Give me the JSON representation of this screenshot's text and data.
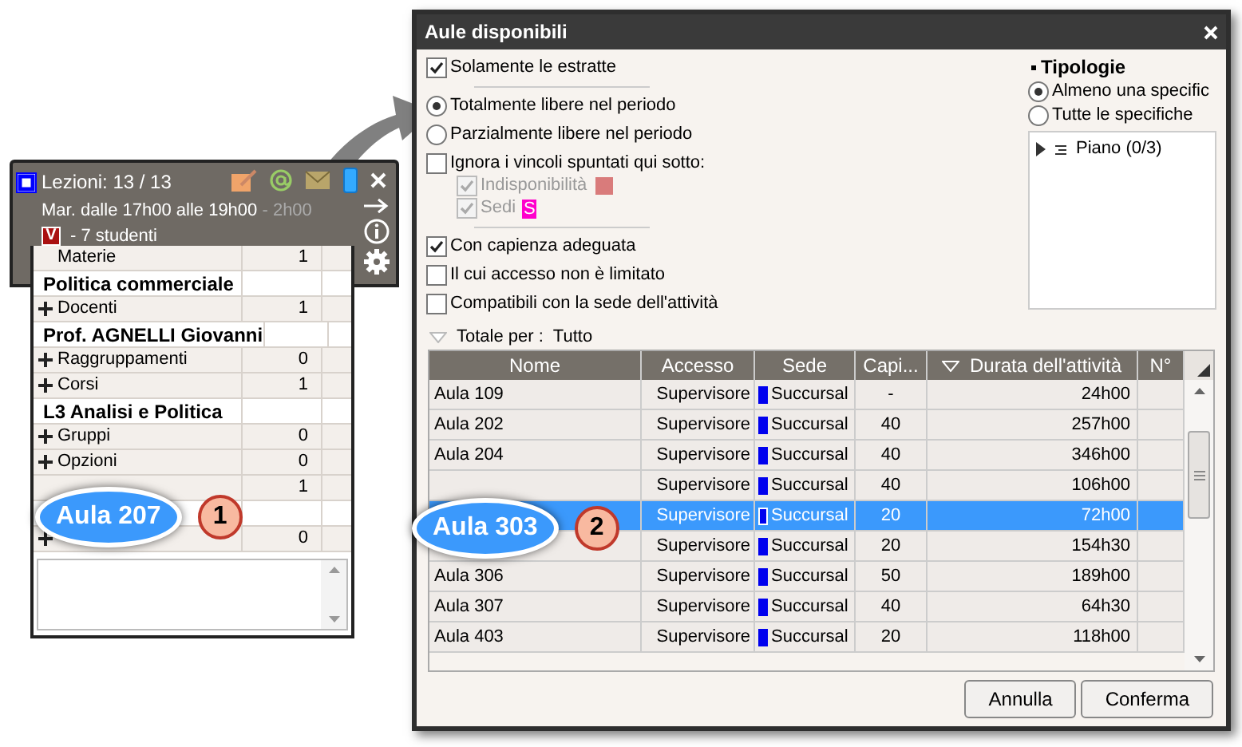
{
  "card": {
    "title": "Lezioni: 13 / 13",
    "schedule": "Mar. dalle 17h00 alle 19h00",
    "duration": " - 2h00",
    "badge": "V",
    "students": "- 7 studenti",
    "rows": [
      {
        "kind": "item",
        "label": "Materie",
        "count": "1",
        "expandable": false
      },
      {
        "kind": "heading",
        "label": "Politica commerciale"
      },
      {
        "kind": "item",
        "label": "Docenti",
        "count": "1",
        "expandable": true
      },
      {
        "kind": "heading",
        "label": "Prof. AGNELLI Giovanni"
      },
      {
        "kind": "item",
        "label": "Raggruppamenti",
        "count": "0",
        "expandable": true
      },
      {
        "kind": "item",
        "label": "Corsi",
        "count": "1",
        "expandable": true
      },
      {
        "kind": "heading",
        "label": "L3 Analisi e Politica"
      },
      {
        "kind": "item",
        "label": "Gruppi",
        "count": "0",
        "expandable": true
      },
      {
        "kind": "item",
        "label": "Opzioni",
        "count": "0",
        "expandable": true
      },
      {
        "kind": "item",
        "count": "1",
        "expandable": false
      },
      {
        "kind": "heading"
      },
      {
        "kind": "item",
        "count": "0",
        "expandable": true
      }
    ]
  },
  "dialog": {
    "title": "Aule disponibili",
    "options": [
      {
        "kind": "checkbox",
        "label": "Solamente le estratte",
        "checked": true
      },
      {
        "kind": "divider"
      },
      {
        "kind": "radio",
        "label": "Totalmente libere nel periodo",
        "selected": true
      },
      {
        "kind": "radio",
        "label": "Parzialmente libere nel periodo",
        "selected": false
      },
      {
        "kind": "checkbox",
        "label": "Ignora i vincoli spuntati qui sotto:",
        "checked": false,
        "children": [
          {
            "label": "Indisponibilità",
            "checked": true,
            "disabled": true,
            "color": "#d97b7b"
          },
          {
            "label": "Sedi",
            "checked": true,
            "disabled": true,
            "color": "#ff00cc",
            "tag": "S"
          }
        ]
      },
      {
        "kind": "divider"
      },
      {
        "kind": "checkbox",
        "label": "Con capienza adeguata",
        "checked": true
      },
      {
        "kind": "checkbox",
        "label": "Il cui accesso non è limitato",
        "checked": false
      },
      {
        "kind": "checkbox",
        "label": "Compatibili con la sede dell'attività",
        "checked": false
      }
    ],
    "tipologie": {
      "title": "Tipologie",
      "radios": [
        {
          "label": "Almeno una specific",
          "selected": true
        },
        {
          "label": "Tutte le specifiche",
          "selected": false
        }
      ],
      "tree": [
        {
          "label": "Piano (0/3)",
          "expanded": false
        }
      ]
    },
    "totals": {
      "label": "Totale per :",
      "value": "Tutto"
    },
    "table": {
      "columns": [
        {
          "label": "Nome",
          "sorted": false
        },
        {
          "label": "Accesso",
          "sorted": false
        },
        {
          "label": "Sede",
          "sorted": false
        },
        {
          "label": "Capi...",
          "sorted": false
        },
        {
          "label": "Durata dell'attività",
          "sorted": true
        },
        {
          "label": "N°",
          "sorted": false
        }
      ],
      "rows": [
        {
          "name": "Aula 109",
          "access": "Supervisore",
          "site": "Succursal",
          "capacity": "-",
          "duration": "24h00",
          "selected": false
        },
        {
          "name": "Aula 202",
          "access": "Supervisore",
          "site": "Succursal",
          "capacity": "40",
          "duration": "257h00",
          "selected": false
        },
        {
          "name": "Aula 204",
          "access": "Supervisore",
          "site": "Succursal",
          "capacity": "40",
          "duration": "346h00",
          "selected": false
        },
        {
          "access": "Supervisore",
          "site": "Succursal",
          "capacity": "40",
          "duration": "106h00",
          "selected": false
        },
        {
          "access": "Supervisore",
          "site": "Succursal",
          "capacity": "20",
          "duration": "72h00",
          "selected": true
        },
        {
          "access": "Supervisore",
          "site": "Succursal",
          "capacity": "20",
          "duration": "154h30",
          "selected": false
        },
        {
          "name": "Aula 306",
          "access": "Supervisore",
          "site": "Succursal",
          "capacity": "50",
          "duration": "189h00",
          "selected": false
        },
        {
          "name": "Aula 307",
          "access": "Supervisore",
          "site": "Succursal",
          "capacity": "40",
          "duration": "64h30",
          "selected": false
        },
        {
          "name": "Aula 403",
          "access": "Supervisore",
          "site": "Succursal",
          "capacity": "20",
          "duration": "118h00",
          "selected": false
        }
      ]
    },
    "buttons": [
      "Annulla",
      "Conferma"
    ]
  },
  "callouts": [
    {
      "label": "Aula 207",
      "number": "1"
    },
    {
      "label": "Aula 303",
      "number": "2"
    }
  ]
}
